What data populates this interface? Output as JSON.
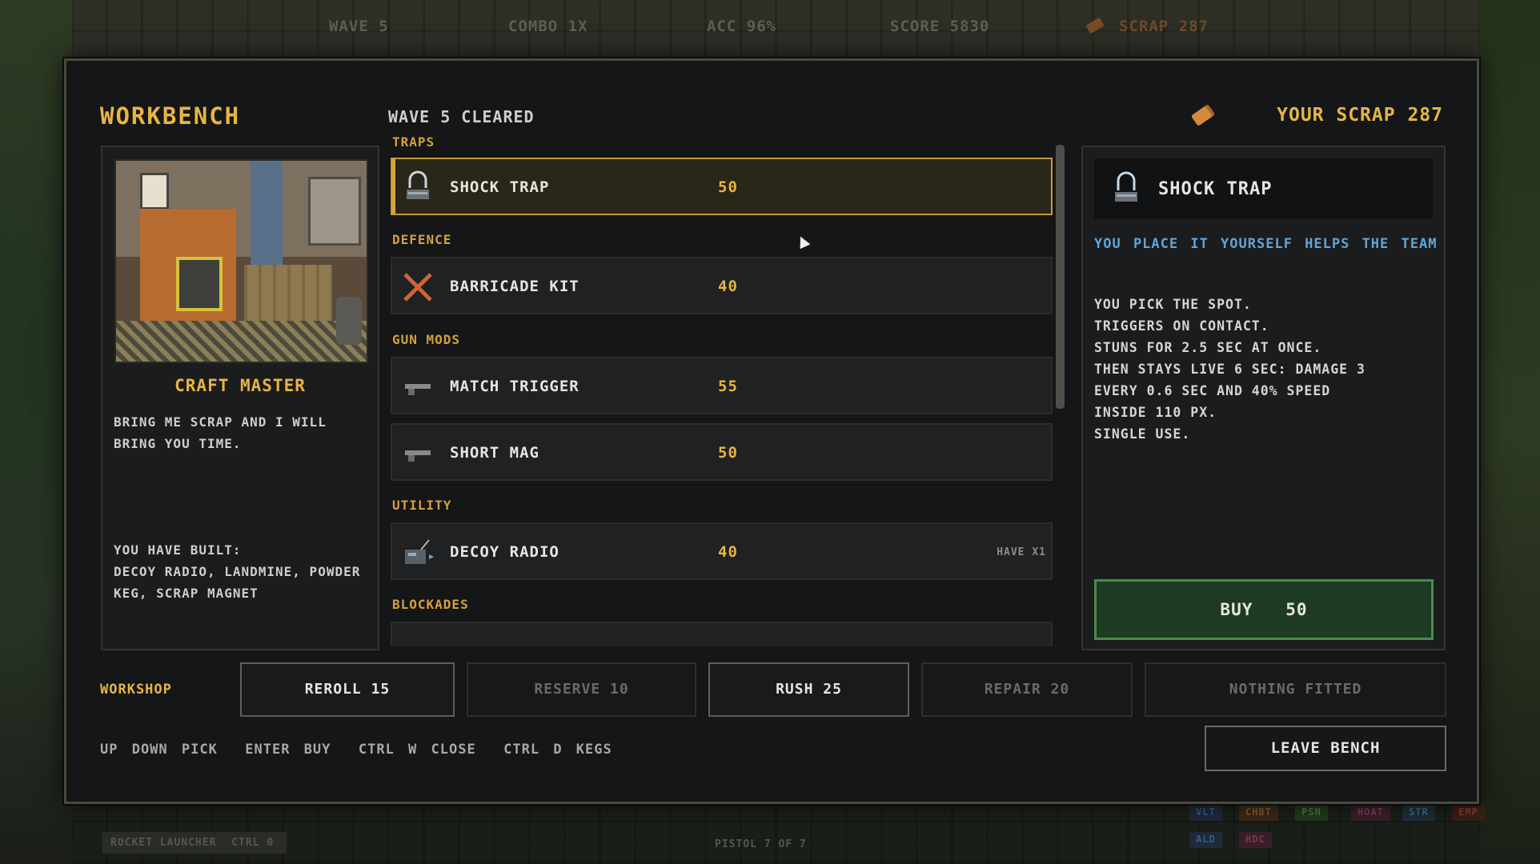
{
  "hud": {
    "wave": "WAVE 5",
    "combo": "COMBO 1X",
    "acc": "ACC 96%",
    "score": "SCORE 5830",
    "scrap": "SCRAP 287"
  },
  "bottom_hud": {
    "weapon_slot": "ROCKET LAUNCHER",
    "weapon_key": "CTRL 0",
    "ammo": "PISTOL 7 OF 7",
    "tags": [
      "VLT",
      "CHBT",
      "PSN",
      "HOAT",
      "STR",
      "EMP",
      "ALD",
      "HDC"
    ]
  },
  "workbench": {
    "title": "WORKBENCH",
    "subtitle": "WAVE 5 CLEARED",
    "your_scrap": "YOUR SCRAP 287"
  },
  "npc": {
    "name": "CRAFT MASTER",
    "quote": "BRING ME SCRAP AND I WILL BRING YOU TIME.",
    "built_label": "YOU HAVE BUILT:",
    "built_list": "DECOY RADIO, LANDMINE, POWDER KEG, SCRAP MAGNET"
  },
  "categories": {
    "traps": "TRAPS",
    "defence": "DEFENCE",
    "gun_mods": "GUN MODS",
    "utility": "UTILITY",
    "blockades": "BLOCKADES"
  },
  "items": [
    {
      "name": "SHOCK TRAP",
      "price": "50",
      "icon": "shock-trap-icon",
      "selected": true
    },
    {
      "name": "BARRICADE KIT",
      "price": "40",
      "icon": "barricade-icon"
    },
    {
      "name": "MATCH TRIGGER",
      "price": "55",
      "icon": "gun-icon"
    },
    {
      "name": "SHORT MAG",
      "price": "50",
      "icon": "gun-icon"
    },
    {
      "name": "DECOY RADIO",
      "price": "40",
      "icon": "radio-icon",
      "have": "HAVE X1"
    }
  ],
  "detail": {
    "name": "SHOCK TRAP",
    "tags": "YOU PLACE IT YOURSELF  HELPS THE TEAM",
    "lines": [
      "YOU PICK THE SPOT.",
      "TRIGGERS ON CONTACT.",
      "STUNS FOR 2.5 SEC AT ONCE.",
      "THEN STAYS LIVE 6 SEC: DAMAGE 3",
      "EVERY 0.6 SEC AND 40% SPEED",
      "INSIDE 110 PX.",
      "SINGLE USE."
    ],
    "buy_label": "BUY   50"
  },
  "workshop": {
    "label": "WORKSHOP",
    "buttons": [
      {
        "label": "REROLL 15",
        "enabled": true
      },
      {
        "label": "RESERVE 10",
        "enabled": false
      },
      {
        "label": "RUSH 25",
        "enabled": true
      },
      {
        "label": "REPAIR 20",
        "enabled": false
      },
      {
        "label": "NOTHING FITTED",
        "enabled": false
      }
    ]
  },
  "hints": "UP DOWN PICK  ENTER BUY  CTRL W CLOSE  CTRL D KEGS",
  "leave_label": "LEAVE BENCH",
  "colors": {
    "accent": "#e8b543",
    "tag_blue": "#5fa6d8",
    "buy_green": "#1f3a23"
  }
}
